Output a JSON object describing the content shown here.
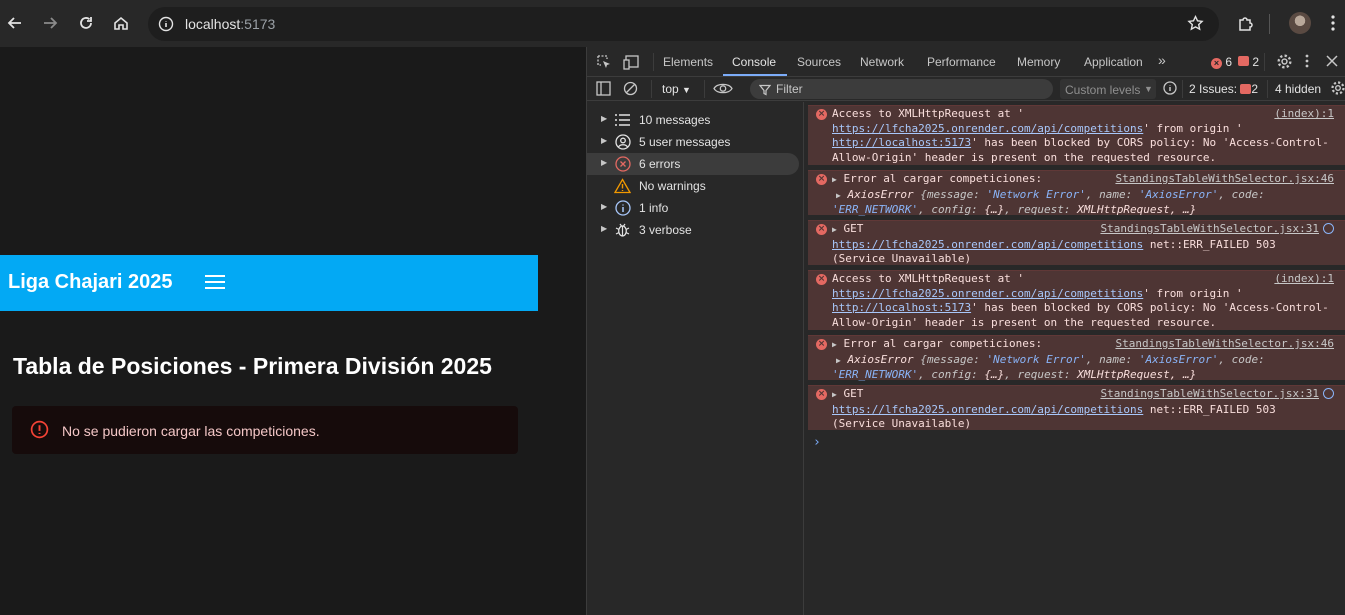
{
  "browser": {
    "url_host": "localhost",
    "url_port": ":5173"
  },
  "app": {
    "title": "Liga Chajari 2025",
    "heading": "Tabla de Posiciones - Primera División 2025",
    "alert_message": "No se pudieron cargar las competiciones."
  },
  "devtools": {
    "tabs": [
      "Elements",
      "Console",
      "Sources",
      "Network",
      "Performance",
      "Memory",
      "Application"
    ],
    "active_tab": "Console",
    "error_count": "6",
    "issue_count": "2",
    "context": "top",
    "filter_placeholder": "Filter",
    "levels": "Custom levels",
    "issues_label": "2 Issues:",
    "issues_badge": "2",
    "hidden_label": "4 hidden",
    "sidebar": [
      {
        "label": "10 messages",
        "icon": "list-icon"
      },
      {
        "label": "5 user messages",
        "icon": "user-icon"
      },
      {
        "label": "6 errors",
        "icon": "error-icon"
      },
      {
        "label": "No warnings",
        "icon": "warning-icon"
      },
      {
        "label": "1 info",
        "icon": "info-icon"
      },
      {
        "label": "3 verbose",
        "icon": "bug-icon"
      }
    ],
    "messages": [
      {
        "source": "(index):1",
        "t1": "Access to XMLHttpRequest at '",
        "u1": "https://lfcha2025.onrender.com/api/competitions",
        "t2": "' from origin '",
        "u2": "http://localhost:5173",
        "t3": "' has been blocked by CORS policy: No 'Access-Control-Allow-Origin' header is present on the requested resource."
      },
      {
        "source": "StandingsTableWithSelector.jsx:46",
        "text": "Error al cargar competiciones:",
        "obj": "AxiosError",
        "k1": "message",
        "v1": "'Network Error'",
        "k2": "name",
        "v2": "'AxiosError'",
        "k3": "code",
        "v3": "'ERR_NETWORK'",
        "k4": "config",
        "v4": "{…}",
        "k5": "request",
        "v5": "XMLHttpRequest, …}"
      },
      {
        "source": "StandingsTableWithSelector.jsx:31",
        "method": "GET",
        "url": "https://lfcha2025.onrender.com/api/competitions",
        "status": "net::ERR_FAILED 503",
        "status2": "(Service Unavailable)"
      },
      {
        "source": "(index):1",
        "t1": "Access to XMLHttpRequest at '",
        "u1": "https://lfcha2025.onrender.com/api/competitions",
        "t2": "' from origin '",
        "u2": "http://localhost:5173",
        "t3": "' has been blocked by CORS policy: No 'Access-Control-Allow-Origin' header is present on the requested resource."
      },
      {
        "source": "StandingsTableWithSelector.jsx:46",
        "text": "Error al cargar competiciones:",
        "obj": "AxiosError",
        "k1": "message",
        "v1": "'Network Error'",
        "k2": "name",
        "v2": "'AxiosError'",
        "k3": "code",
        "v3": "'ERR_NETWORK'",
        "k4": "config",
        "v4": "{…}",
        "k5": "request",
        "v5": "XMLHttpRequest, …}"
      },
      {
        "source": "StandingsTableWithSelector.jsx:31",
        "method": "GET",
        "url": "https://lfcha2025.onrender.com/api/competitions",
        "status": "net::ERR_FAILED 503",
        "status2": "(Service Unavailable)"
      }
    ]
  }
}
